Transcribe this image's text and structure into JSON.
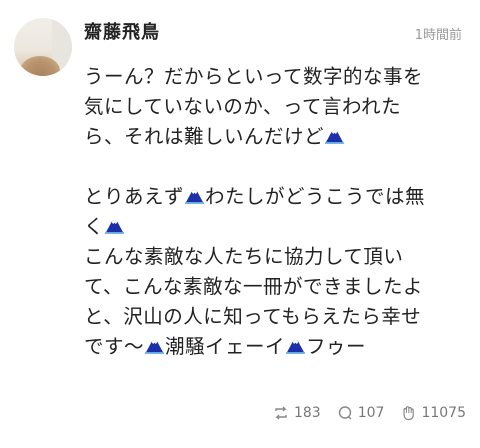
{
  "post": {
    "author": "齋藤飛鳥",
    "time": "1時間前",
    "text": {
      "l1": "うーん？だからといって数字的な事を",
      "l2": "気にしていないのか、って言われた",
      "l3a": "ら、それは難しいんだけど",
      "l4a": "とりあえず",
      "l4b": "わたしがどうこうでは無",
      "l5a": "く",
      "l6": "こんな素敵な人たちに協力して頂い",
      "l7": "て、こんな素敵な一冊ができましたよ",
      "l8": "と、沢山の人に知ってもらえたら幸せ",
      "l9a": "です〜",
      "l9b": "潮騒イェーイ",
      "l9c": "フゥー"
    },
    "emoji_icon": "mount-fuji-icon"
  },
  "stats": {
    "repost_icon": "repost-icon",
    "reposts": "183",
    "comment_icon": "comment-icon",
    "comments": "107",
    "clap_icon": "clap-icon",
    "claps": "11075"
  },
  "colors": {
    "fuji_blue": "#1c2fa8",
    "fuji_snow": "#ffffff",
    "muted": "#9a9a9a"
  }
}
